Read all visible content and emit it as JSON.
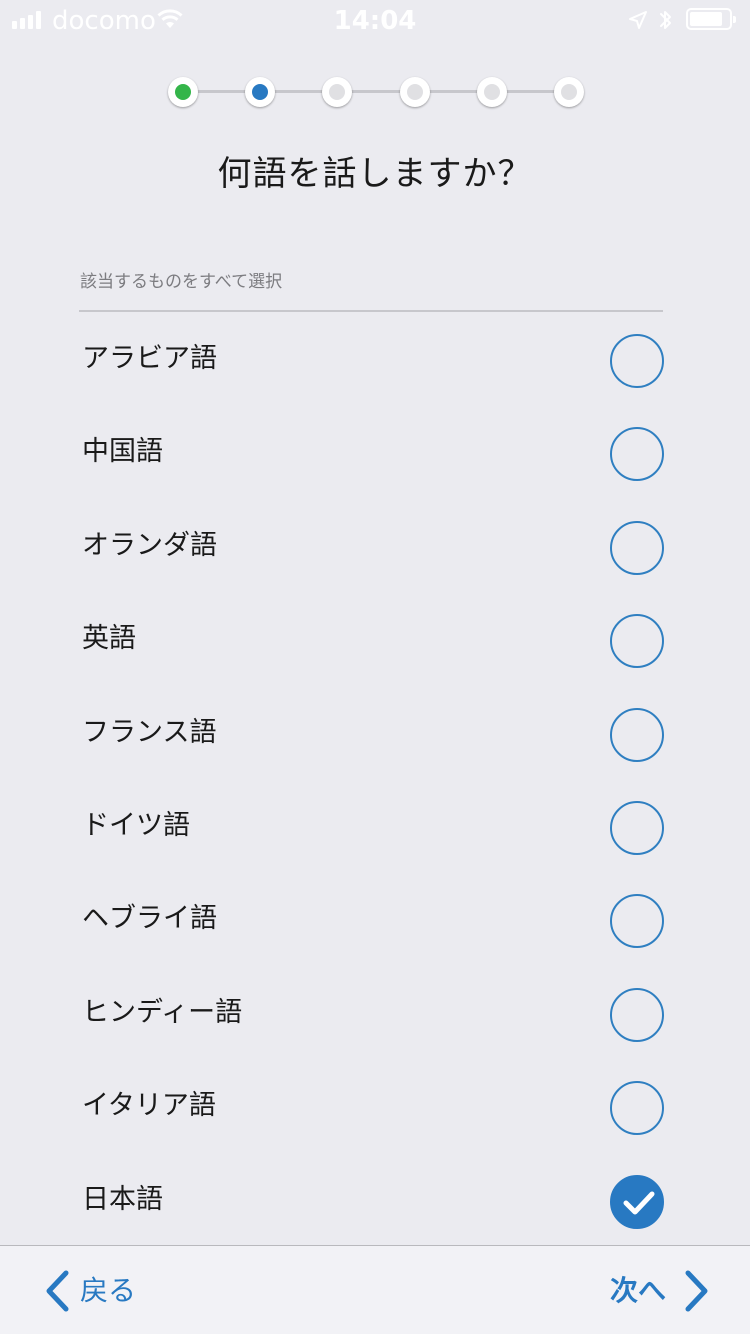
{
  "status_bar": {
    "carrier": "docomo",
    "time": "14:04",
    "battery_level": 0.85,
    "icons": [
      "signal-icon",
      "wifi-icon",
      "location-icon",
      "bluetooth-icon",
      "battery-icon"
    ]
  },
  "stepper": {
    "total_steps": 6,
    "current_step": 2,
    "completed_color": "#34b54a",
    "active_color": "#2879c2",
    "pending_color": "#e0e0e3"
  },
  "page": {
    "title": "何語を話しますか？",
    "hint": "該当するものをすべて選択"
  },
  "languages": [
    {
      "label": "アラビア語",
      "selected": false
    },
    {
      "label": "中国語",
      "selected": false
    },
    {
      "label": "オランダ語",
      "selected": false
    },
    {
      "label": "英語",
      "selected": false
    },
    {
      "label": "フランス語",
      "selected": false
    },
    {
      "label": "ドイツ語",
      "selected": false
    },
    {
      "label": "ヘブライ語",
      "selected": false
    },
    {
      "label": "ヒンディー語",
      "selected": false
    },
    {
      "label": "イタリア語",
      "selected": false
    },
    {
      "label": "日本語",
      "selected": true
    }
  ],
  "toolbar": {
    "back_label": "戻る",
    "next_label": "次へ",
    "accent_color": "#2879c2"
  }
}
